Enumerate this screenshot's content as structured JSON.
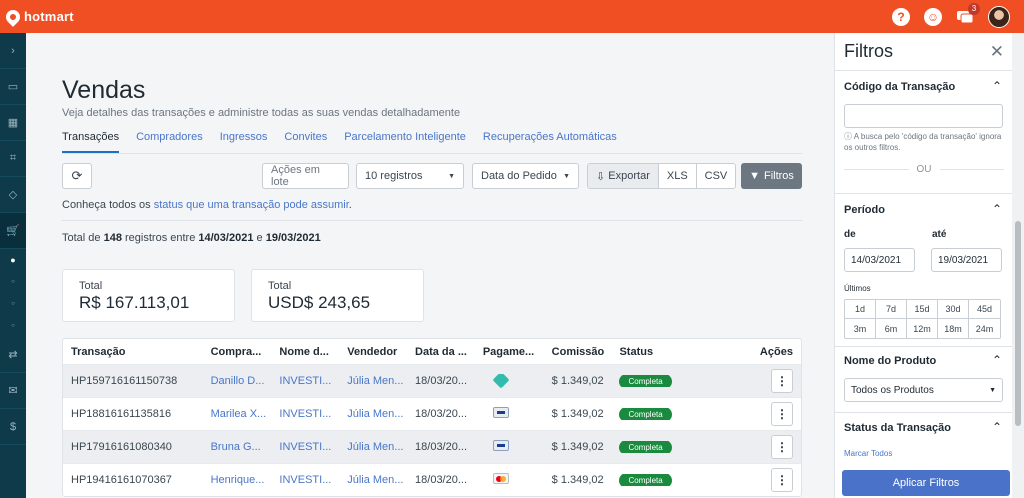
{
  "brand": {
    "name": "hotmart",
    "color": "#f04e23"
  },
  "topbar": {
    "notifications_count": "3",
    "help_icon": "question-icon",
    "apps_icon": "headset-icon",
    "chat_icon": "chat-icon"
  },
  "sidebar": {
    "icons": [
      "chevron-right-icon",
      "dashboard-icon",
      "grid-icon",
      "scan-icon",
      "box-icon",
      "cart-icon",
      "transfer-icon",
      "messages-icon",
      "coin-icon"
    ]
  },
  "page": {
    "title": "Vendas",
    "subtitle": "Veja detalhes das transações e administre todas as suas vendas detalhadamente",
    "tabs": [
      {
        "label": "Transações",
        "active": true
      },
      {
        "label": "Compradores"
      },
      {
        "label": "Ingressos"
      },
      {
        "label": "Convites"
      },
      {
        "label": "Parcelamento Inteligente"
      },
      {
        "label": "Recuperações Automáticas"
      }
    ]
  },
  "toolbar": {
    "lote_label": "Ações em lote",
    "registros_label": "10 registros",
    "data_label": "Data do Pedido",
    "exportar_label": "Exportar",
    "xls_label": "XLS",
    "csv_label": "CSV",
    "filtros_label": "Filtros"
  },
  "status_info": {
    "prefix": "Conheça todos os",
    "link": "status que uma transação pode assumir",
    "suffix": "."
  },
  "totals": {
    "prefix": "Total de",
    "count": "148",
    "middle": "registros entre",
    "start": "14/03/2021",
    "and": "e",
    "end": "19/03/2021"
  },
  "cards": [
    {
      "label": "Total",
      "value": "R$ 167.113,01"
    },
    {
      "label": "Total",
      "value": "USD$ 243,65"
    }
  ],
  "table": {
    "headers": [
      "Transação",
      "Compra...",
      "Nome d...",
      "Vendedor",
      "Data da ...",
      "Pagame...",
      "Comissão",
      "Status",
      "Ações"
    ],
    "rows": [
      {
        "transacao": "HP159716161150738",
        "comprador": "Danillo D...",
        "produto": "INVESTI...",
        "vendedor": "Júlia Men...",
        "data": "18/03/20...",
        "pagamento": "pix-icon",
        "comissao": "$ 1.349,02",
        "status": "Completa"
      },
      {
        "transacao": "HP18816161135816",
        "comprador": "Marilea X...",
        "produto": "INVESTI...",
        "vendedor": "Júlia Men...",
        "data": "18/03/20...",
        "pagamento": "visa-card-icon",
        "comissao": "$ 1.349,02",
        "status": "Completa"
      },
      {
        "transacao": "HP17916161080340",
        "comprador": "Bruna G...",
        "produto": "INVESTI...",
        "vendedor": "Júlia Men...",
        "data": "18/03/20...",
        "pagamento": "visa-card-icon",
        "comissao": "$ 1.349,02",
        "status": "Completa"
      },
      {
        "transacao": "HP19416161070367",
        "comprador": "Henrique...",
        "produto": "INVESTI...",
        "vendedor": "Júlia Men...",
        "data": "18/03/20...",
        "pagamento": "mastercard-icon",
        "comissao": "$ 1.349,02",
        "status": "Completa"
      }
    ]
  },
  "filters": {
    "title": "Filtros",
    "codigo": {
      "title": "Código da Transação",
      "value": "",
      "note": "A busca pelo 'código da transação' ignora os outros filtros.",
      "or": "OU"
    },
    "periodo": {
      "title": "Período",
      "de_label": "de",
      "ate_label": "até",
      "de_value": "14/03/2021",
      "ate_value": "19/03/2021",
      "ultimos_label": "Últimos",
      "options": [
        "1d",
        "7d",
        "15d",
        "30d",
        "45d",
        "3m",
        "6m",
        "12m",
        "18m",
        "24m"
      ]
    },
    "produto": {
      "title": "Nome do Produto",
      "value": "Todos os Produtos"
    },
    "status": {
      "title": "Status da Transação",
      "marcar": "Marcar Todos"
    },
    "apply_label": "Aplicar Filtros"
  }
}
